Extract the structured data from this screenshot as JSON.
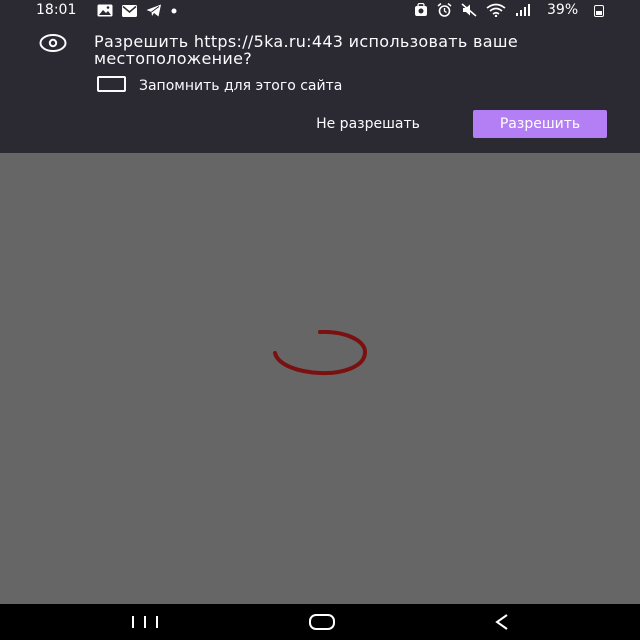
{
  "status_bar": {
    "time": "18:01",
    "battery": "39%",
    "icons_left": [
      "gallery-icon",
      "mail-icon",
      "telegram-icon",
      "dot-icon"
    ],
    "icons_right": [
      "vpn-icon",
      "alarm-icon",
      "mute-icon",
      "wifi-icon",
      "signal-icon",
      "battery-icon"
    ]
  },
  "permission_prompt": {
    "message": "Разрешить https://5ka.ru:443 использовать ваше местоположение?",
    "remember_label": "Запомнить для этого сайта",
    "remember_checked": false,
    "deny_label": "Не разрешать",
    "allow_label": "Разрешить",
    "icon": "location-icon",
    "accent_color": "#b47ff5"
  },
  "content": {
    "loading_indicator": "spinner",
    "spinner_color": "#7a1010"
  },
  "nav_bar": {
    "buttons": [
      "recents-button",
      "home-button",
      "back-button"
    ]
  }
}
